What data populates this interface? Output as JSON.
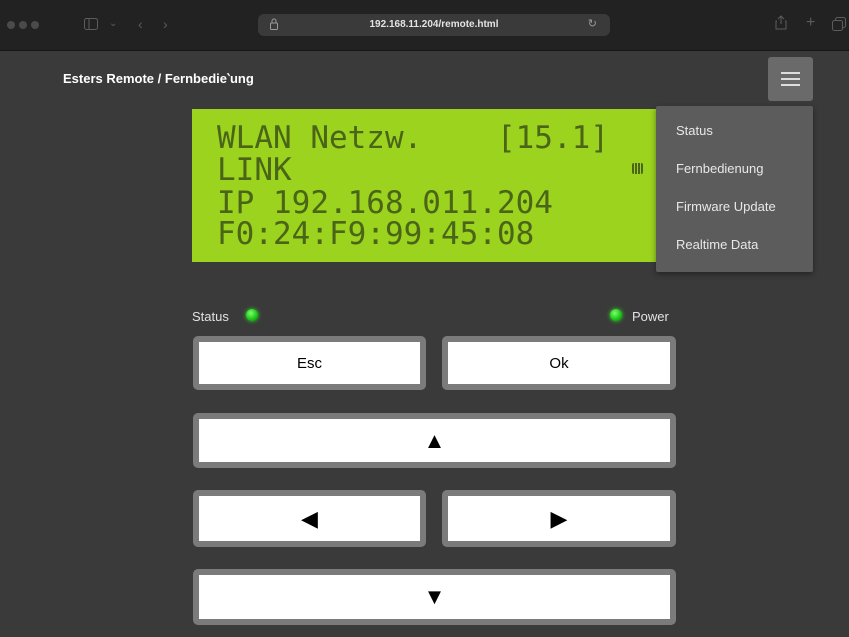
{
  "browser": {
    "url": "192.168.11.204/remote.html"
  },
  "page": {
    "title": "Esters Remote / Fernbedie‵ung"
  },
  "menu": {
    "items": [
      "Status",
      "Fernbedienung",
      "Firmware Update",
      "Realtime Data"
    ]
  },
  "lcd": {
    "lines": [
      "WLAN Netzw.    [15.1]",
      "LINK",
      "IP 192.168.011.204",
      "F0:24:F9:99:45:08"
    ]
  },
  "leds": {
    "status_label": "Status",
    "power_label": "Power",
    "color": "#18c214"
  },
  "keys": {
    "esc": "Esc",
    "ok": "Ok",
    "up": "▲",
    "left": "◀",
    "right": "▶",
    "down": "▼"
  },
  "colors": {
    "lcd_background": "#9bd31f",
    "lcd_text": "#4a6418",
    "page_background": "#3a3a3a"
  }
}
